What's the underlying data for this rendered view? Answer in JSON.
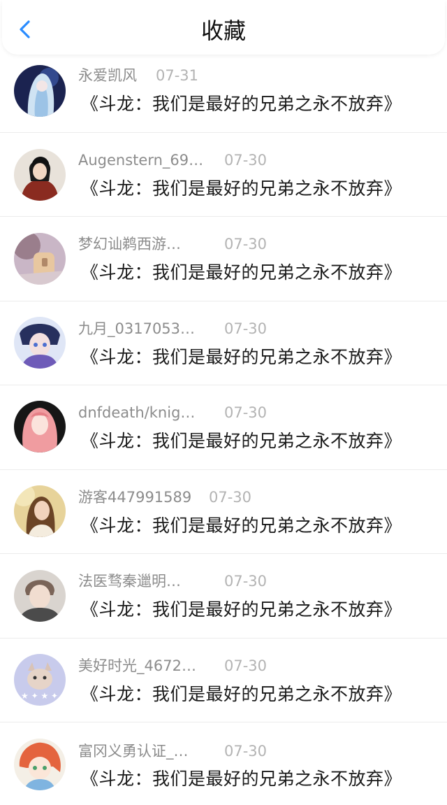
{
  "header": {
    "title": "收藏",
    "back_icon": "chevron-left-icon",
    "accent_color": "#2a8cff"
  },
  "items": [
    {
      "user": "永爱凯风",
      "date": "07-31",
      "work": "《斗龙：我们是最好的兄弟之永不放弃》",
      "avatar_icon": "anime-avatar-icon"
    },
    {
      "user": "Augenstern_69…",
      "date": "07-30",
      "work": "《斗龙：我们是最好的兄弟之永不放弃》",
      "avatar_icon": "anime-avatar-icon"
    },
    {
      "user": "梦幻讪鹈西游…",
      "date": "07-30",
      "work": "《斗龙：我们是最好的兄弟之永不放弃》",
      "avatar_icon": "photo-avatar-icon"
    },
    {
      "user": "九月_0317053…",
      "date": "07-30",
      "work": "《斗龙：我们是最好的兄弟之永不放弃》",
      "avatar_icon": "anime-avatar-icon"
    },
    {
      "user": "dnfdeath/knig…",
      "date": "07-30",
      "work": "《斗龙：我们是最好的兄弟之永不放弃》",
      "avatar_icon": "anime-avatar-icon"
    },
    {
      "user": "游客447991589",
      "date": "07-30",
      "work": "《斗龙：我们是最好的兄弟之永不放弃》",
      "avatar_icon": "photo-avatar-icon"
    },
    {
      "user": "法医骛秦邋明…",
      "date": "07-30",
      "work": "《斗龙：我们是最好的兄弟之永不放弃》",
      "avatar_icon": "photo-avatar-icon"
    },
    {
      "user": "美好时光_4672…",
      "date": "07-30",
      "work": "《斗龙：我们是最好的兄弟之永不放弃》",
      "avatar_icon": "cat-avatar-icon"
    },
    {
      "user": "富冈义勇认证_…",
      "date": "07-30",
      "work": "《斗龙：我们是最好的兄弟之永不放弃》",
      "avatar_icon": "anime-avatar-icon"
    }
  ]
}
